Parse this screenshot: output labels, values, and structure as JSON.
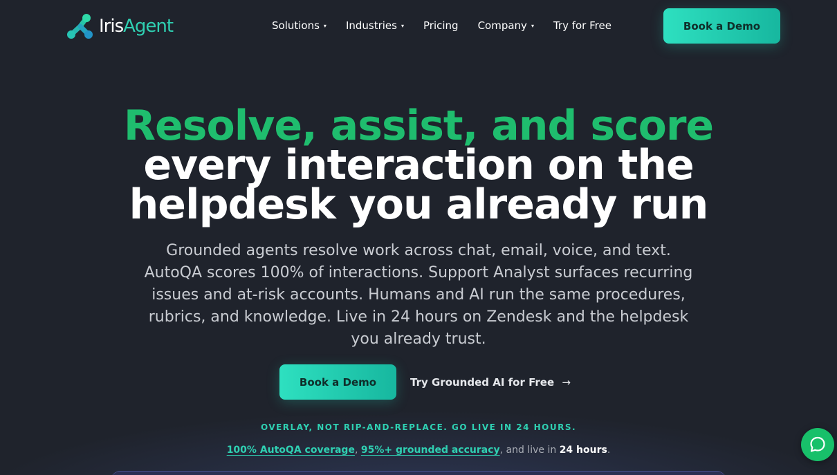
{
  "brand": {
    "logo_iris": "Iris",
    "logo_agent": "Agent",
    "accent_color": "#2fd0b2",
    "headline_color": "#1fbd6e",
    "background_color": "#1f232c"
  },
  "nav": {
    "items": [
      {
        "label": "Solutions",
        "has_dropdown": true
      },
      {
        "label": "Industries",
        "has_dropdown": true
      },
      {
        "label": "Pricing",
        "has_dropdown": false
      },
      {
        "label": "Company",
        "has_dropdown": true
      },
      {
        "label": "Try for Free",
        "has_dropdown": false
      }
    ],
    "cta_label": "Book a Demo",
    "caret": "▾"
  },
  "hero": {
    "line1": "Resolve, assist, and score",
    "line2": "every interaction on the",
    "line3": "helpdesk you already run",
    "subtitle": "Grounded agents resolve work across chat, email, voice, and text. AutoQA scores 100% of interactions. Support Analyst surfaces recurring issues and at-risk accounts. Humans and AI run the same procedures, rubrics, and knowledge. Live in 24 hours on Zendesk and the helpdesk you already trust.",
    "primary_cta": "Book a Demo",
    "secondary_cta": "Try Grounded AI for Free",
    "secondary_arrow": "→",
    "overlay_text": "OVERLAY, NOT RIP-AND-REPLACE. GO LIVE IN 24 HOURS.",
    "stats": {
      "link1": "100% AutoQA coverage",
      "sep1": ", ",
      "link2": "95%+ grounded accuracy",
      "middle": ", and live in ",
      "strong": "24 hours",
      "end": "."
    }
  },
  "chat_widget": {
    "icon": "chat-bubble-icon"
  }
}
